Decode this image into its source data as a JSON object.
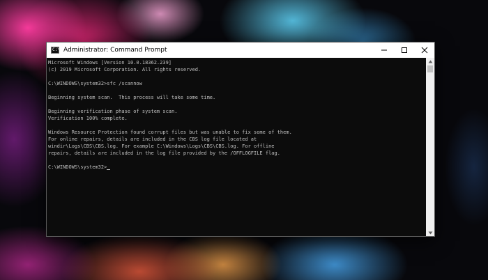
{
  "window": {
    "title": "Administrator: Command Prompt",
    "icon": "console-icon",
    "icon_text": "C:\\"
  },
  "controls": {
    "minimize": "minimize-icon",
    "maximize": "maximize-icon",
    "close": "close-icon"
  },
  "console": {
    "lines": [
      "Microsoft Windows [Version 10.0.18362.239]",
      "(c) 2019 Microsoft Corporation. All rights reserved.",
      "",
      "C:\\WINDOWS\\system32>sfc /scannow",
      "",
      "Beginning system scan.  This process will take some time.",
      "",
      "Beginning verification phase of system scan.",
      "Verification 100% complete.",
      "",
      "Windows Resource Protection found corrupt files but was unable to fix some of them.",
      "For online repairs, details are included in the CBS log file located at",
      "windir\\Logs\\CBS\\CBS.log. For example C:\\Windows\\Logs\\CBS\\CBS.log. For offline",
      "repairs, details are included in the log file provided by the /OFFLOGFILE flag.",
      "",
      "C:\\WINDOWS\\system32>"
    ],
    "text_color": "#c0c0c0",
    "background_color": "#0c0c0c"
  },
  "scrollbar": {
    "up": "scroll-up-arrow-icon",
    "down": "scroll-down-arrow-icon"
  }
}
